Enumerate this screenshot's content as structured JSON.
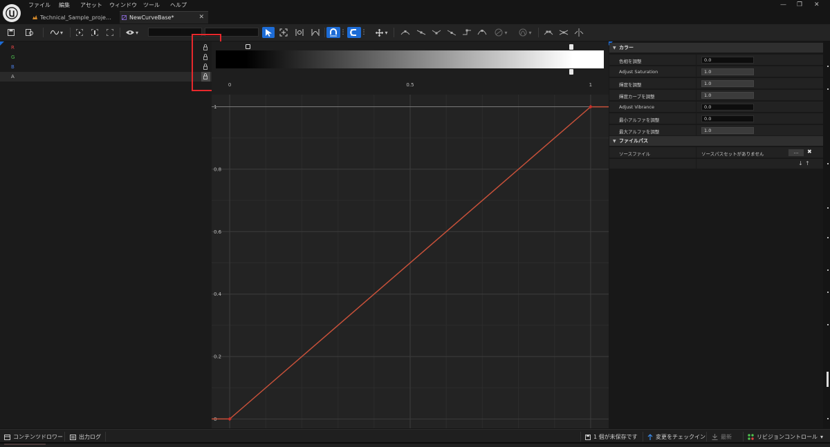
{
  "menu": [
    "ファイル",
    "編集",
    "アセット",
    "ウィンドウ",
    "ツール",
    "ヘルプ"
  ],
  "window_controls": {
    "minimize": "—",
    "restore": "❐",
    "close": "✕"
  },
  "tabs": [
    {
      "label": "Technical_Sample_proje…",
      "close": ""
    },
    {
      "label": "NewCurveBase*",
      "close": "✕"
    }
  ],
  "toolbar": {
    "curve_tool_arrow": "▾",
    "view_arrow": "▾",
    "transform_arrow": "▾",
    "kebab": "⋮"
  },
  "channels": [
    {
      "label": "R",
      "color": "#e04444"
    },
    {
      "label": "G",
      "color": "#4ec24e"
    },
    {
      "label": "B",
      "color": "#4a7be0"
    },
    {
      "label": "A",
      "color": "#bdbdbd"
    }
  ],
  "chart_data": {
    "type": "line",
    "x_ticks": [
      "0",
      "0.5",
      "1"
    ],
    "y_ticks": [
      "1",
      "0.8",
      "0.6",
      "0.4",
      "0.2",
      "0"
    ],
    "xlim": [
      -0.05,
      1.05
    ],
    "ylim": [
      -0.03,
      1.03
    ],
    "grid": true,
    "series": [
      {
        "color": "#c8513a",
        "x": [
          -0.05,
          0,
          1,
          1.05
        ],
        "y": [
          0,
          0,
          1,
          1
        ]
      }
    ],
    "keys": [
      {
        "x": 0,
        "y": 0
      },
      {
        "x": 1,
        "y": 1
      }
    ],
    "gradient_stops": [
      0,
      1
    ]
  },
  "details": {
    "categories": [
      {
        "label": "カラー",
        "arrow": "▼",
        "rows": [
          {
            "label": "色相を調整",
            "value": "0.0",
            "style": "field"
          },
          {
            "label": "Adjust Saturation",
            "value": "1.0",
            "style": "bar"
          },
          {
            "label": "輝度を調整",
            "value": "1.0",
            "style": "bar"
          },
          {
            "label": "輝度カーブを調整",
            "value": "1.0",
            "style": "bar"
          },
          {
            "label": "Adjust Vibrance",
            "value": "0.0",
            "style": "field"
          },
          {
            "label": "最小アルファを調整",
            "value": "0.0",
            "style": "field"
          },
          {
            "label": "最大アルファを調整",
            "value": "1.0",
            "style": "bar"
          }
        ]
      },
      {
        "label": "ファイルパス",
        "arrow": "▼",
        "rows": [
          {
            "label": "ソースファイル",
            "value": "ソースパスセットがありません",
            "button": "...",
            "clear": "✖"
          }
        ]
      }
    ],
    "reorder": {
      "down": "↓",
      "up": "↑"
    }
  },
  "statusbar": {
    "content_drawer": "コンテンツドロワー",
    "output_log": "出力ログ",
    "unsaved": "1 個が未保存です",
    "check_in": "変更をチェックイン",
    "latest": "最新",
    "revision_control": "リビジョンコントロール",
    "revision_arrow": "▾"
  }
}
